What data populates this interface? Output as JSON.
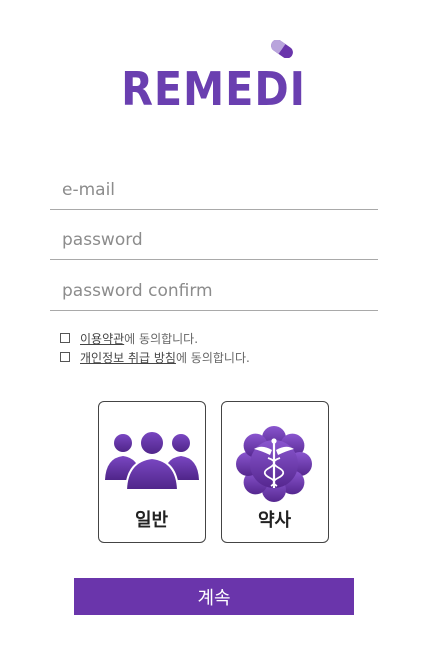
{
  "brand": {
    "logo_text": "REMEDI",
    "accent_color": "#6a35ab"
  },
  "form": {
    "email_placeholder": "e-mail",
    "password_placeholder": "password",
    "password_confirm_placeholder": "password confirm"
  },
  "agreements": [
    {
      "link_text": "이용약관",
      "suffix": "에 동의합니다."
    },
    {
      "link_text": "개인정보 취급 방침",
      "suffix": "에 동의합니다."
    }
  ],
  "user_types": [
    {
      "label": "일반",
      "icon": "people-icon"
    },
    {
      "label": "약사",
      "icon": "caduceus-icon"
    }
  ],
  "continue_label": "계속"
}
